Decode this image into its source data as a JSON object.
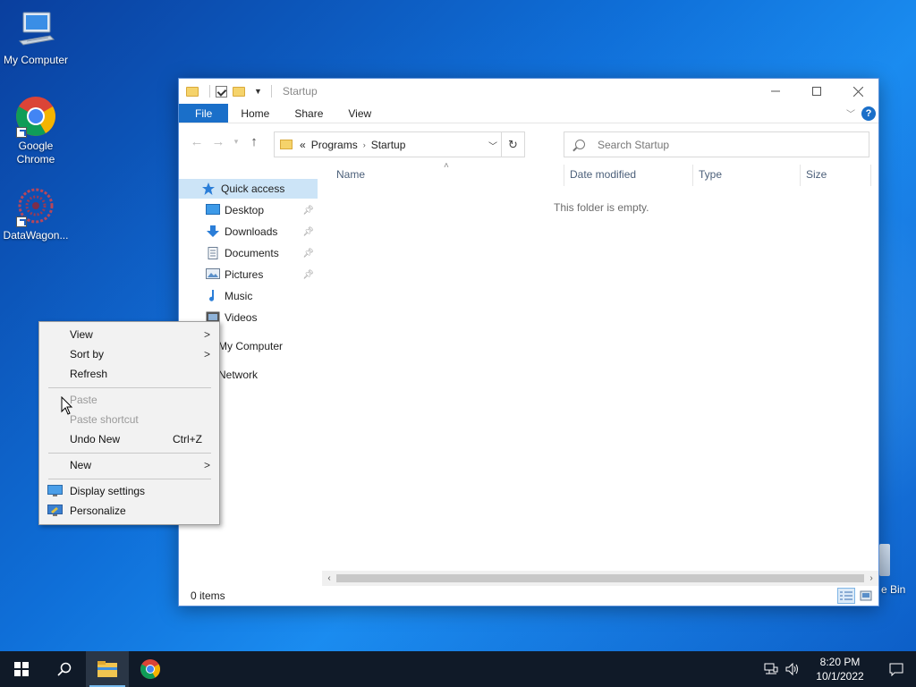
{
  "desktop": {
    "icons": [
      {
        "label": "My Computer"
      },
      {
        "label": "Google Chrome"
      },
      {
        "label": "DataWagon..."
      }
    ],
    "recycle_bin_label": "e Bin"
  },
  "explorer": {
    "title": "Startup",
    "ribbon_tabs": [
      "File",
      "Home",
      "Share",
      "View"
    ],
    "help_label": "?",
    "address": {
      "overflow": "«",
      "crumbs": [
        "Programs",
        "Startup"
      ]
    },
    "search_placeholder": "Search Startup",
    "nav_pane": {
      "quick_access": "Quick access",
      "pinned": [
        "Desktop",
        "Downloads",
        "Documents",
        "Pictures"
      ],
      "others": [
        "Music",
        "Videos"
      ],
      "my_computer": "My Computer",
      "network": "Network"
    },
    "columns": [
      "Name",
      "Date modified",
      "Type",
      "Size"
    ],
    "empty_message": "This folder is empty.",
    "status": "0 items"
  },
  "context_menu": {
    "view": "View",
    "sort_by": "Sort by",
    "refresh": "Refresh",
    "paste": "Paste",
    "paste_shortcut": "Paste shortcut",
    "undo_new": "Undo New",
    "undo_accel": "Ctrl+Z",
    "new": "New",
    "display_settings": "Display settings",
    "personalize": "Personalize"
  },
  "taskbar": {
    "time": "8:20 PM",
    "date": "10/1/2022"
  },
  "colors": {
    "accent": "#1a6fc9",
    "selection": "#cce4f7",
    "taskbar": "#101a28"
  }
}
